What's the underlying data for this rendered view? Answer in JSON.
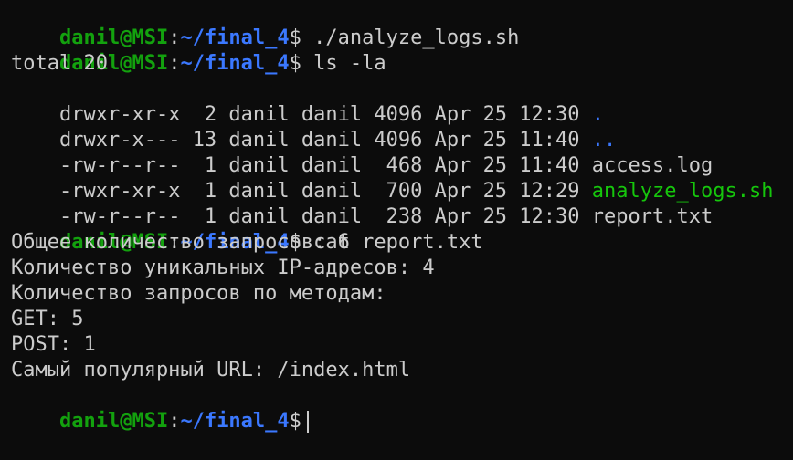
{
  "prompt": {
    "user_host": "danil@MSI",
    "colon": ":",
    "path": "~/final_4",
    "symbol": "$"
  },
  "commands": {
    "cmd1": " ./analyze_logs.sh",
    "cmd2": " ls -la",
    "cmd3": " cat report.txt"
  },
  "ls_output": {
    "total": "total 20",
    "rows": [
      {
        "meta": "drwxr-xr-x  2 danil danil 4096 Apr 25 12:30 ",
        "name": "."
      },
      {
        "meta": "drwxr-x--- 13 danil danil 4096 Apr 25 11:40 ",
        "name": ".."
      },
      {
        "meta": "-rw-r--r--  1 danil danil  468 Apr 25 11:40 ",
        "name": "access.log"
      },
      {
        "meta": "-rwxr-xr-x  1 danil danil  700 Apr 25 12:29 ",
        "name": "analyze_logs.sh"
      },
      {
        "meta": "-rw-r--r--  1 danil danil  238 Apr 25 12:30 ",
        "name": "report.txt"
      }
    ]
  },
  "report_output": [
    "Общее количество запросов: 6",
    "Количество уникальных IP-адресов: 4",
    "Количество запросов по методам:",
    "GET: 5",
    "POST: 1",
    "Самый популярный URL: /index.html"
  ],
  "colors": {
    "background": "#0c0c0c",
    "text": "#cccccc",
    "user_host": "#13a10e",
    "path": "#3b78ff",
    "directory": "#3b78ff",
    "executable": "#16c60c"
  }
}
